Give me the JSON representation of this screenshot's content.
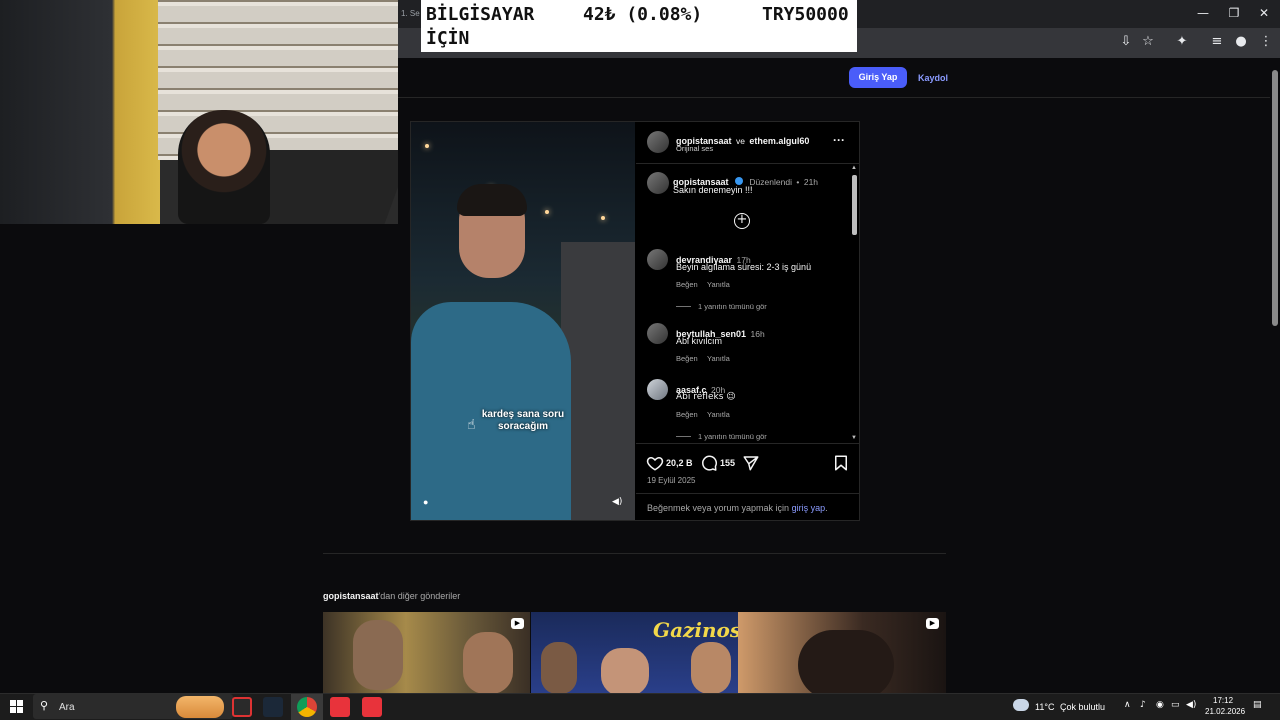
{
  "browser": {
    "tab_hint": "1. Se",
    "window_controls": [
      "—",
      "❐",
      "✕"
    ]
  },
  "price_banner": {
    "label_line1": "BİLGİSAYAR",
    "label_line2": "İÇİN",
    "change": "42₺ (0.08%)",
    "goal": "TRY50000"
  },
  "header": {
    "login_label": "Giriş Yap",
    "signup_label": "Kaydol"
  },
  "post": {
    "authors": {
      "user1": "gopistansaat",
      "connector": "ve",
      "user2": "ethem.algul60"
    },
    "audio": "Orijinal ses",
    "more_label": "···",
    "video_caption": "kardeş sana soru soracağım",
    "caption": {
      "username": "gopistansaat",
      "edited": "Düzenlendi",
      "bullet": "•",
      "time": "21h",
      "text": "Sakın denemeyin !!!"
    },
    "comments": [
      {
        "username": "devrandiyaar",
        "time": "17h",
        "text": "Beyin algılama süresi: 2-3 iş günü",
        "like": "Beğen",
        "reply": "Yanıtla",
        "view_replies": "1 yanıtın tümünü gör"
      },
      {
        "username": "beytullah_sen01",
        "time": "16h",
        "text": "Abi kıvılcım",
        "like": "Beğen",
        "reply": "Yanıtla"
      },
      {
        "username": "aasaf.c",
        "time": "20h",
        "text": "Abi refleks 😉",
        "like": "Beğen",
        "reply": "Yanıtla",
        "view_replies": "1 yanıtın tümünü gör"
      }
    ],
    "likes": "20,2 B",
    "comment_count": "155",
    "date": "19 Eylül 2025",
    "login_prompt_pre": "Beğenmek veya yorum yapmak için ",
    "login_prompt_link": "giriş yap",
    "login_prompt_post": "."
  },
  "more_posts": {
    "username": "gopistansaat",
    "suffix": "'dan diğer gönderiler",
    "thumb_sign": "Gazinosu"
  },
  "taskbar": {
    "search_label": "Ara",
    "weather_temp": "11°C",
    "weather_desc": "Çok bulutlu",
    "time": "17:12",
    "date": "21.02.2026"
  },
  "colors": {
    "accent": "#4a5df9",
    "link": "#8b9bff",
    "background": "#0b0b0d"
  }
}
